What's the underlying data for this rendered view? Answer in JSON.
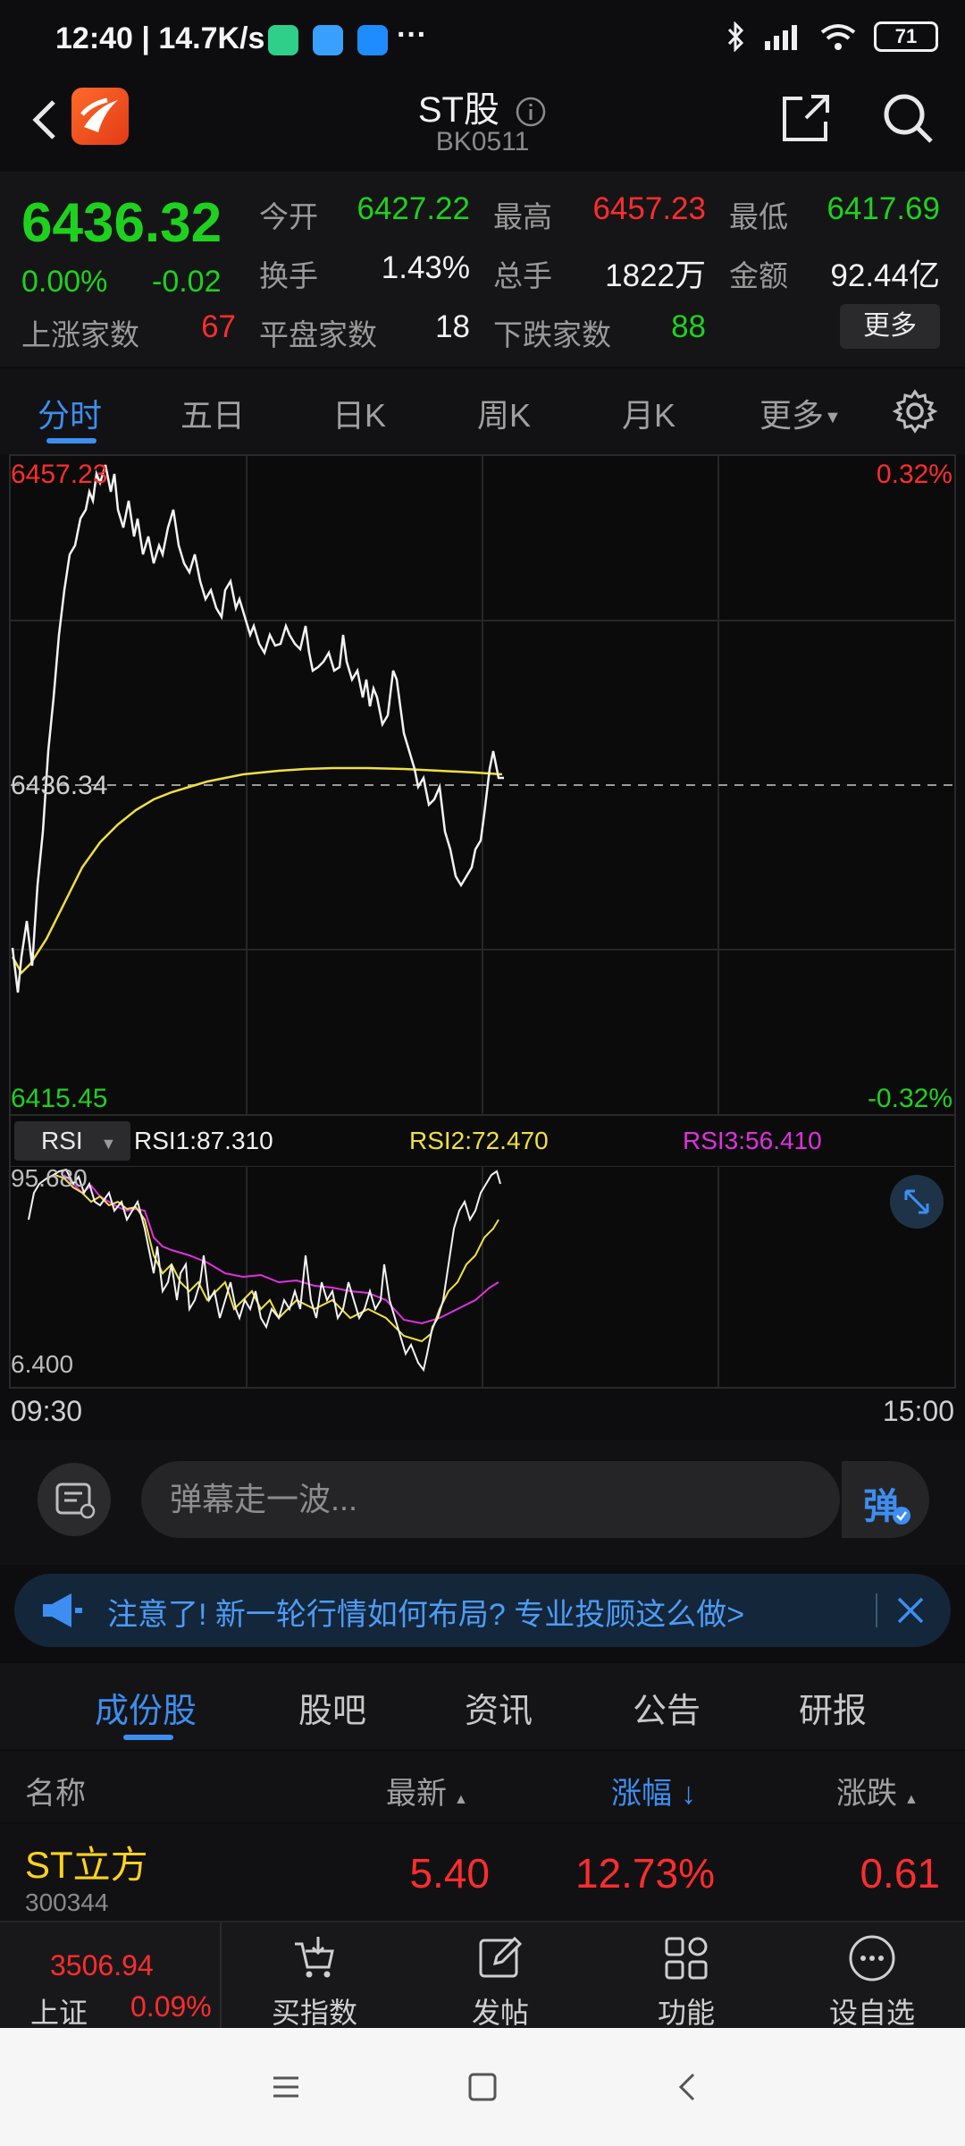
{
  "status": {
    "time_speed": "12:40 | 14.7K/s",
    "battery": "71"
  },
  "header": {
    "title": "ST股",
    "code": "BK0511"
  },
  "quote": {
    "price": "6436.32",
    "change_pct": "0.00%",
    "change_val": "-0.02",
    "fields": {
      "open_label": "今开",
      "open": "6427.22",
      "high_label": "最高",
      "high": "6457.23",
      "low_label": "最低",
      "low": "6417.69",
      "turnover_label": "换手",
      "turnover": "1.43%",
      "volume_label": "总手",
      "volume": "1822万",
      "amount_label": "金额",
      "amount": "92.44亿",
      "up_label": "上涨家数",
      "up": "67",
      "flat_label": "平盘家数",
      "flat": "18",
      "down_label": "下跌家数",
      "down": "88"
    },
    "more": "更多"
  },
  "tabs": [
    "分时",
    "五日",
    "日K",
    "周K",
    "月K",
    "更多"
  ],
  "chart": {
    "top_price": "6457.23",
    "mid_price": "6436.34",
    "bottom_price": "6415.45",
    "top_pct": "0.32%",
    "bottom_pct": "-0.32%",
    "time_start": "09:30",
    "time_end": "15:00"
  },
  "rsi": {
    "select": "RSI",
    "rsi1": "RSI1:87.310",
    "rsi2": "RSI2:72.470",
    "rsi3": "RSI3:56.410",
    "top": "95.680",
    "bottom": "6.400"
  },
  "danmu": {
    "placeholder": "弹幕走一波...",
    "send": "弹"
  },
  "notice": {
    "text": "注意了! 新一轮行情如何布局? 专业投顾这么做>"
  },
  "subtabs": [
    "成份股",
    "股吧",
    "资讯",
    "公告",
    "研报"
  ],
  "list": {
    "headers": {
      "name": "名称",
      "latest": "最新",
      "pct": "涨幅",
      "chg": "涨跌"
    },
    "rows": [
      {
        "name": "ST立方",
        "code": "300344",
        "latest": "5.40",
        "pct": "12.73%",
        "chg": "0.61"
      }
    ]
  },
  "bottom_nav": {
    "index_value": "3506.94",
    "index_name": "上证",
    "index_pct": "0.09%",
    "items": [
      "买指数",
      "发帖",
      "功能",
      "设自选"
    ]
  },
  "colors": {
    "up": "#ff2d2d",
    "down": "#1fd11f",
    "accent": "#3d8ef0",
    "rsi1": "#ffffff",
    "rsi2": "#f0e040",
    "rsi3": "#e030e0"
  }
}
